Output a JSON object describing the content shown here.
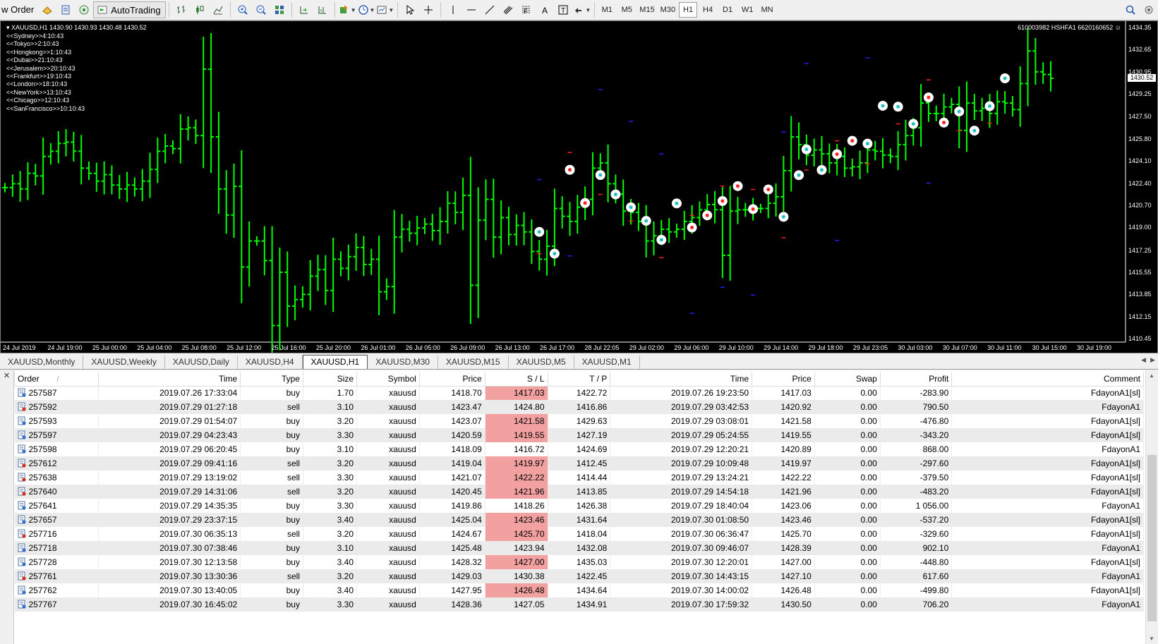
{
  "toolbar": {
    "new_order_label": "w Order",
    "autotrading_label": "AutoTrading",
    "timeframes": [
      "M1",
      "M5",
      "M15",
      "M30",
      "H1",
      "H4",
      "D1",
      "W1",
      "MN"
    ],
    "active_timeframe": "H1",
    "icons": [
      "new-order-icon",
      "expert-icon",
      "market-watch-icon",
      "data-window-icon",
      "autotrading-icon",
      "bar-chart-icon",
      "candlestick-icon",
      "line-chart-icon",
      "zoom-in-icon",
      "zoom-out-icon",
      "tile-windows-icon",
      "autoscroll-icon",
      "chart-shift-icon",
      "indicators-icon",
      "periods-icon",
      "templates-icon",
      "cursor-icon",
      "crosshair-icon",
      "vertical-line-icon",
      "horizontal-line-icon",
      "trendline-icon",
      "channel-icon",
      "fibonacci-icon",
      "text-icon",
      "text-label-icon",
      "arrows-icon",
      "search-icon",
      "settings-icon"
    ]
  },
  "chart": {
    "symbol_info": "XAUUSD,H1  1430.90 1430.93 1430.48 1430.52",
    "account_info": "610003982 HSHFA1 6620160652",
    "current_price": "1430.52",
    "timezones": [
      "<<Sydney>>4:10:43",
      "<<Tokyo>>2:10:43",
      "<<Hongkong>>1:10:43",
      "<<Dubai>>21:10:43",
      "<<Jerusalem>>20:10:43",
      "<<Frankfurt>>19:10:43",
      "<<London>>18:10:43",
      "<<NewYork>>13:10:43",
      "<<Chicago>>12:10:43",
      "<<SanFrancisco>>10:10:43"
    ],
    "price_axis": [
      "1434.35",
      "1432.65",
      "1430.95",
      "1429.25",
      "1427.50",
      "1425.80",
      "1424.10",
      "1422.40",
      "1420.70",
      "1419.00",
      "1417.25",
      "1415.55",
      "1413.85",
      "1412.15",
      "1410.45"
    ],
    "time_axis": [
      "24 Jul 2019",
      "24 Jul 19:00",
      "25 Jul 00:00",
      "25 Jul 04:00",
      "25 Jul 08:00",
      "25 Jul 12:00",
      "25 Jul 16:00",
      "25 Jul 20:00",
      "26 Jul 01:00",
      "26 Jul 05:00",
      "26 Jul 09:00",
      "26 Jul 13:00",
      "26 Jul 17:00",
      "28 Jul 22:05",
      "29 Jul 02:00",
      "29 Jul 06:00",
      "29 Jul 10:00",
      "29 Jul 14:00",
      "29 Jul 18:00",
      "29 Jul 23:05",
      "30 Jul 03:00",
      "30 Jul 07:00",
      "30 Jul 11:00",
      "30 Jul 15:00",
      "30 Jul 19:00"
    ],
    "colors": {
      "background": "#000000",
      "bar": "#00ff00",
      "sl_marker": "#ff2020",
      "tp_marker": "#2020ff",
      "trade_marker": "#ffffff",
      "axis_text": "#ffffff"
    }
  },
  "chart_data": {
    "type": "ohlc",
    "symbol": "XAUUSD",
    "timeframe": "H1",
    "ylim": [
      1410.45,
      1434.35
    ],
    "close": [
      1422.1,
      1422.4,
      1422.0,
      1423.2,
      1423.0,
      1424.5,
      1424.9,
      1425.5,
      1425.6,
      1424.9,
      1423.6,
      1423.2,
      1422.6,
      1423.1,
      1422.3,
      1422.0,
      1422.3,
      1422.0,
      1422.6,
      1423.5,
      1424.9,
      1425.3,
      1425.1,
      1426.6,
      1426.7,
      1426.1,
      1431.2,
      1426.0,
      1422.0,
      1420.0,
      1422.2,
      1416.0,
      1418.0,
      1418.0,
      1416.5,
      1411.5,
      1415.6,
      1413.0,
      1413.5,
      1413.9,
      1415.3,
      1415.8,
      1414.2,
      1416.6,
      1415.9,
      1416.8,
      1417.5,
      1416.2,
      1416.6,
      1414.1,
      1414.5,
      1418.3,
      1418.9,
      1418.6,
      1419.0,
      1419.3,
      1418.8,
      1419.5,
      1420.9,
      1420.2,
      1421.5,
      1414.6,
      1419.6,
      1421.2,
      1418.3,
      1419.8,
      1418.5,
      1419.2,
      1418.7,
      1417.2,
      1416.6,
      1417.6,
      1420.5,
      1419.9,
      1419.5,
      1420.6,
      1421.2,
      1423.6,
      1424.0,
      1422.4,
      1421.6,
      1420.3,
      1420.2,
      1419.5,
      1418.0,
      1418.4,
      1418.9,
      1418.7,
      1418.9,
      1419.5,
      1419.8,
      1420.4,
      1420.8,
      1420.4,
      1416.9,
      1420.3,
      1420.4,
      1420.4,
      1420.5,
      1420.5,
      1420.9,
      1421.4,
      1423.4,
      1426.0,
      1425.4,
      1424.6,
      1425.0,
      1424.7,
      1424.0,
      1424.5,
      1423.6,
      1423.7,
      1424.0,
      1425.0,
      1424.9,
      1424.6,
      1424.5,
      1425.4,
      1426.1,
      1426.7,
      1428.6,
      1427.8,
      1427.8,
      1428.3,
      1428.5,
      1426.5,
      1428.6,
      1428.0,
      1428.2,
      1427.8,
      1428.7,
      1428.6,
      1428.1,
      1430.1,
      1432.6,
      1431.0,
      1430.8,
      1430.5
    ],
    "trade_markers": [
      {
        "order": "257587",
        "type": "buy",
        "open_time": "2019.07.26 17:33:04",
        "open_price": 1418.7,
        "close_time": "2019.07.26 19:23:50",
        "close_price": 1417.03
      },
      {
        "order": "257592",
        "type": "sell",
        "open_time": "2019.07.29 01:27:18",
        "open_price": 1423.47,
        "close_time": "2019.07.29 03:42:53",
        "close_price": 1420.92
      },
      {
        "order": "257641",
        "type": "buy",
        "open_time": "2019.07.29 14:35:35",
        "open_price": 1419.86,
        "close_time": "2019.07.29 18:40:04",
        "close_price": 1423.06
      },
      {
        "order": "257728",
        "type": "buy",
        "open_time": "2019.07.30 12:13:58",
        "open_price": 1428.32,
        "close_time": "2019.07.30 12:20:01",
        "close_price": 1427.0
      },
      {
        "order": "257767",
        "type": "buy",
        "open_time": "2019.07.30 16:45:02",
        "open_price": 1428.36,
        "close_time": "2019.07.30 17:59:32",
        "close_price": 1430.5
      }
    ]
  },
  "tabs": [
    "XAUUSD,Monthly",
    "XAUUSD,Weekly",
    "XAUUSD,Daily",
    "XAUUSD,H4",
    "XAUUSD,H1",
    "XAUUSD,M30",
    "XAUUSD,M15",
    "XAUUSD,M5",
    "XAUUSD,M1"
  ],
  "active_tab": "XAUUSD,H1",
  "history": {
    "columns": [
      "Order",
      "Time",
      "Type",
      "Size",
      "Symbol",
      "Price",
      "S / L",
      "T / P",
      "Time",
      "Price",
      "Swap",
      "Profit",
      "Comment"
    ],
    "sort_indicator": "/",
    "rows": [
      {
        "order": "257587",
        "open_time": "2019.07.26 17:33:04",
        "type": "buy",
        "size": "1.70",
        "symbol": "xauusd",
        "price": "1418.70",
        "sl": "1417.03",
        "tp": "1422.72",
        "close_time": "2019.07.26 19:23:50",
        "close_price": "1417.03",
        "swap": "0.00",
        "profit": "-283.90",
        "comment": "FdayonA1[sl]",
        "sl_hit": true
      },
      {
        "order": "257592",
        "open_time": "2019.07.29 01:27:18",
        "type": "sell",
        "size": "3.10",
        "symbol": "xauusd",
        "price": "1423.47",
        "sl": "1424.80",
        "tp": "1416.86",
        "close_time": "2019.07.29 03:42:53",
        "close_price": "1420.92",
        "swap": "0.00",
        "profit": "790.50",
        "comment": "FdayonA1",
        "sl_hit": false
      },
      {
        "order": "257593",
        "open_time": "2019.07.29 01:54:07",
        "type": "buy",
        "size": "3.20",
        "symbol": "xauusd",
        "price": "1423.07",
        "sl": "1421.58",
        "tp": "1429.63",
        "close_time": "2019.07.29 03:08:01",
        "close_price": "1421.58",
        "swap": "0.00",
        "profit": "-476.80",
        "comment": "FdayonA1[sl]",
        "sl_hit": true
      },
      {
        "order": "257597",
        "open_time": "2019.07.29 04:23:43",
        "type": "buy",
        "size": "3.30",
        "symbol": "xauusd",
        "price": "1420.59",
        "sl": "1419.55",
        "tp": "1427.19",
        "close_time": "2019.07.29 05:24:55",
        "close_price": "1419.55",
        "swap": "0.00",
        "profit": "-343.20",
        "comment": "FdayonA1[sl]",
        "sl_hit": true
      },
      {
        "order": "257598",
        "open_time": "2019.07.29 06:20:45",
        "type": "buy",
        "size": "3.10",
        "symbol": "xauusd",
        "price": "1418.09",
        "sl": "1416.72",
        "tp": "1424.69",
        "close_time": "2019.07.29 12:20:21",
        "close_price": "1420.89",
        "swap": "0.00",
        "profit": "868.00",
        "comment": "FdayonA1",
        "sl_hit": false
      },
      {
        "order": "257612",
        "open_time": "2019.07.29 09:41:16",
        "type": "sell",
        "size": "3.20",
        "symbol": "xauusd",
        "price": "1419.04",
        "sl": "1419.97",
        "tp": "1412.45",
        "close_time": "2019.07.29 10:09:48",
        "close_price": "1419.97",
        "swap": "0.00",
        "profit": "-297.60",
        "comment": "FdayonA1[sl]",
        "sl_hit": true
      },
      {
        "order": "257638",
        "open_time": "2019.07.29 13:19:02",
        "type": "sell",
        "size": "3.30",
        "symbol": "xauusd",
        "price": "1421.07",
        "sl": "1422.22",
        "tp": "1414.44",
        "close_time": "2019.07.29 13:24:21",
        "close_price": "1422.22",
        "swap": "0.00",
        "profit": "-379.50",
        "comment": "FdayonA1[sl]",
        "sl_hit": true
      },
      {
        "order": "257640",
        "open_time": "2019.07.29 14:31:06",
        "type": "sell",
        "size": "3.20",
        "symbol": "xauusd",
        "price": "1420.45",
        "sl": "1421.96",
        "tp": "1413.85",
        "close_time": "2019.07.29 14:54:18",
        "close_price": "1421.96",
        "swap": "0.00",
        "profit": "-483.20",
        "comment": "FdayonA1[sl]",
        "sl_hit": true
      },
      {
        "order": "257641",
        "open_time": "2019.07.29 14:35:35",
        "type": "buy",
        "size": "3.30",
        "symbol": "xauusd",
        "price": "1419.86",
        "sl": "1418.26",
        "tp": "1426.38",
        "close_time": "2019.07.29 18:40:04",
        "close_price": "1423.06",
        "swap": "0.00",
        "profit": "1 056.00",
        "comment": "FdayonA1",
        "sl_hit": false
      },
      {
        "order": "257657",
        "open_time": "2019.07.29 23:37:15",
        "type": "buy",
        "size": "3.40",
        "symbol": "xauusd",
        "price": "1425.04",
        "sl": "1423.46",
        "tp": "1431.64",
        "close_time": "2019.07.30 01:08:50",
        "close_price": "1423.46",
        "swap": "0.00",
        "profit": "-537.20",
        "comment": "FdayonA1[sl]",
        "sl_hit": true
      },
      {
        "order": "257716",
        "open_time": "2019.07.30 06:35:13",
        "type": "sell",
        "size": "3.20",
        "symbol": "xauusd",
        "price": "1424.67",
        "sl": "1425.70",
        "tp": "1418.04",
        "close_time": "2019.07.30 06:36:47",
        "close_price": "1425.70",
        "swap": "0.00",
        "profit": "-329.60",
        "comment": "FdayonA1[sl]",
        "sl_hit": true
      },
      {
        "order": "257718",
        "open_time": "2019.07.30 07:38:46",
        "type": "buy",
        "size": "3.10",
        "symbol": "xauusd",
        "price": "1425.48",
        "sl": "1423.94",
        "tp": "1432.08",
        "close_time": "2019.07.30 09:46:07",
        "close_price": "1428.39",
        "swap": "0.00",
        "profit": "902.10",
        "comment": "FdayonA1",
        "sl_hit": false
      },
      {
        "order": "257728",
        "open_time": "2019.07.30 12:13:58",
        "type": "buy",
        "size": "3.40",
        "symbol": "xauusd",
        "price": "1428.32",
        "sl": "1427.00",
        "tp": "1435.03",
        "close_time": "2019.07.30 12:20:01",
        "close_price": "1427.00",
        "swap": "0.00",
        "profit": "-448.80",
        "comment": "FdayonA1[sl]",
        "sl_hit": true
      },
      {
        "order": "257761",
        "open_time": "2019.07.30 13:30:36",
        "type": "sell",
        "size": "3.20",
        "symbol": "xauusd",
        "price": "1429.03",
        "sl": "1430.38",
        "tp": "1422.45",
        "close_time": "2019.07.30 14:43:15",
        "close_price": "1427.10",
        "swap": "0.00",
        "profit": "617.60",
        "comment": "FdayonA1",
        "sl_hit": false
      },
      {
        "order": "257762",
        "open_time": "2019.07.30 13:40:05",
        "type": "buy",
        "size": "3.40",
        "symbol": "xauusd",
        "price": "1427.95",
        "sl": "1426.48",
        "tp": "1434.64",
        "close_time": "2019.07.30 14:00:02",
        "close_price": "1426.48",
        "swap": "0.00",
        "profit": "-499.80",
        "comment": "FdayonA1[sl]",
        "sl_hit": true
      },
      {
        "order": "257767",
        "open_time": "2019.07.30 16:45:02",
        "type": "buy",
        "size": "3.30",
        "symbol": "xauusd",
        "price": "1428.36",
        "sl": "1427.05",
        "tp": "1434.91",
        "close_time": "2019.07.30 17:59:32",
        "close_price": "1430.50",
        "swap": "0.00",
        "profit": "706.20",
        "comment": "FdayonA1",
        "sl_hit": false
      }
    ]
  }
}
